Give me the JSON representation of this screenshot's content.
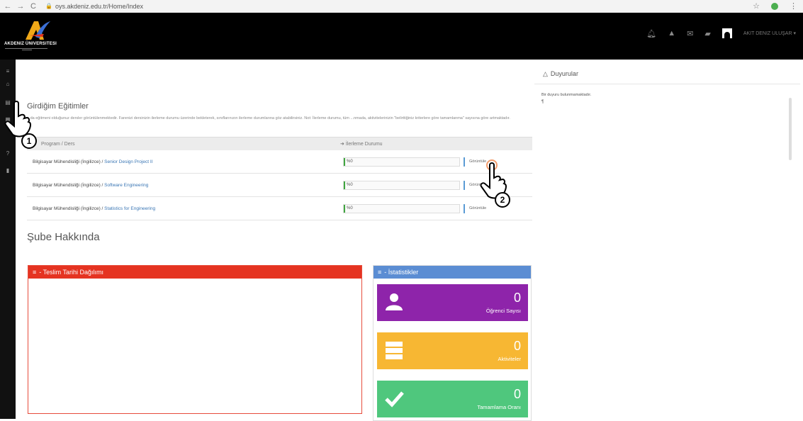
{
  "browser": {
    "url": "oys.akdeniz.edu.tr/Home/Index"
  },
  "header": {
    "logo_text": "AKDENIZ ÜNIVERSITESI",
    "user_name": "AKIT DENIZ ULUŞAR"
  },
  "main": {
    "section_title": "Girdiğim Eğitimler",
    "description": "...da eğitmeni olduğunuz dersler görüntülenmektedir. Farenizi dersinizin ilerleme durumu üzerinde bekleterek, sınıflarınızın ilerleme durumlarına göz atabilirsiniz. Not: İlerleme durumu, tüm ...nmada, aktivitelerinizin \"belirttiğiniz kriterlere göre tamamlanma\" sayısına göre artmaktadır.",
    "table": {
      "col_program": "Program / Ders",
      "col_progress": "İlerleme Durumu",
      "rows": [
        {
          "program": "Bilgisayar Mühendisliği (İngilizce) /",
          "course": "Senior Design Project II",
          "progress": "%0",
          "progress_value": 0,
          "action": "Görüntüle"
        },
        {
          "program": "Bilgisayar Mühendisliği (İngilizce) /",
          "course": "Software Engineering",
          "progress": "%0",
          "progress_value": 0,
          "action": "Görüntüle"
        },
        {
          "program": "Bilgisayar Mühendisliği (İngilizce) /",
          "course": "Statistics for Engineering",
          "progress": "%0",
          "progress_value": 0,
          "action": "Görüntüle"
        }
      ]
    },
    "branch_title": "Şube Hakkında",
    "deadline_panel_title": "- Teslim Tarihi Dağılımı",
    "stats_panel_title": "- İstatistikler",
    "stats": [
      {
        "value": "0",
        "label": "Öğrenci Sayısı",
        "color": "#8e24aa"
      },
      {
        "value": "0",
        "label": "Aktiviteler",
        "color": "#f7b733"
      },
      {
        "value": "0",
        "label": "Tamamlama Oranı",
        "color": "#4fc77d"
      }
    ]
  },
  "announcements": {
    "title": "Duyurular",
    "empty_text": "Bir duyuru bulunmamaktadır."
  },
  "overlay": {
    "step1": "1",
    "step2": "2"
  },
  "colors": {
    "header_bg": "#000000",
    "red_panel": "#e53321",
    "blue_panel": "#5b8dd3"
  }
}
